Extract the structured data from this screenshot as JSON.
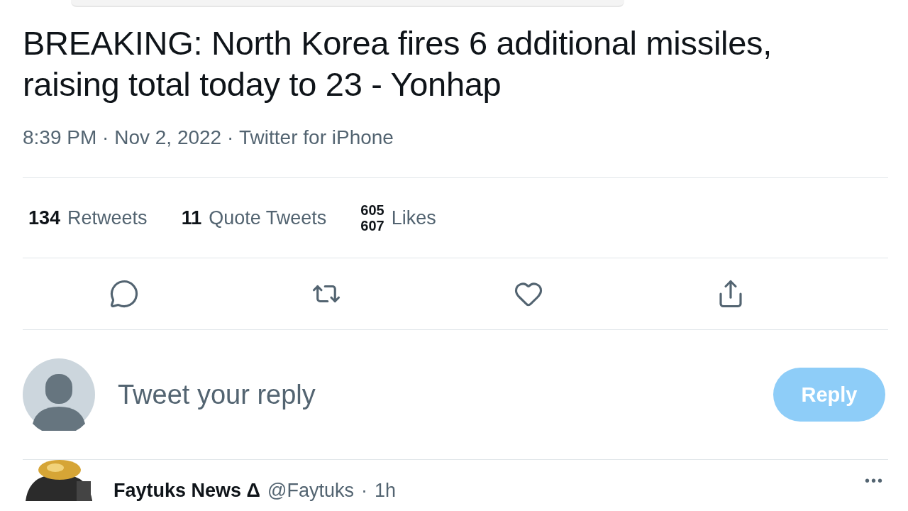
{
  "tweet": {
    "text": "BREAKING: North Korea fires 6 additional missiles, raising total today to 23 - Yonhap",
    "time": "8:39 PM",
    "date": "Nov 2, 2022",
    "source": "Twitter for iPhone",
    "separators": [
      " · ",
      " · "
    ]
  },
  "stats": [
    {
      "kind": "count",
      "count": "134",
      "label": "Retweets"
    },
    {
      "kind": "count",
      "count": "11",
      "label": "Quote Tweets"
    },
    {
      "kind": "rolling",
      "values": [
        "605",
        "607"
      ],
      "label": "Likes"
    }
  ],
  "actions": [
    {
      "kind": "reply"
    },
    {
      "kind": "retweet"
    },
    {
      "kind": "like"
    },
    {
      "kind": "share"
    }
  ],
  "composer": {
    "placeholder": "Tweet your reply",
    "button": {
      "label": "Reply",
      "disabled": true
    }
  },
  "next_tweet": {
    "name": "Faytuks News Δ",
    "handle": "@Faytuks",
    "age": "1h",
    "separator": "·",
    "more": "•••"
  }
}
